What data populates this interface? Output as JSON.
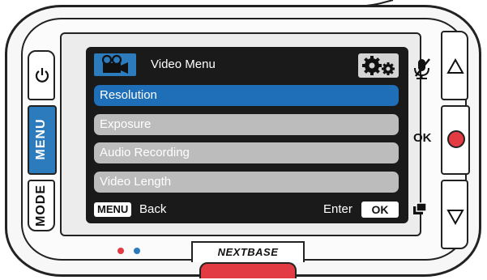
{
  "screen": {
    "title": "Video Menu",
    "items": [
      {
        "label": "Resolution",
        "selected": true
      },
      {
        "label": "Exposure",
        "selected": false
      },
      {
        "label": "Audio Recording",
        "selected": false
      },
      {
        "label": "Video Length",
        "selected": false
      }
    ],
    "footer": {
      "menu_key": "MENU",
      "back_label": "Back",
      "enter_label": "Enter",
      "ok_key": "OK"
    }
  },
  "device": {
    "menu_button_label": "MENU",
    "mode_button_label": "MODE",
    "ok_label": "OK",
    "brand": "NEXTBASE"
  },
  "icons": {
    "menu_header": "video-camera-icon",
    "settings": "gears-icon",
    "power": "power-icon",
    "mic": "mic-muted-icon",
    "up": "triangle-up-icon",
    "record": "record-dot-icon",
    "protect": "protect-file-icon",
    "down": "triangle-down-icon"
  },
  "colors": {
    "accent_blue": "#1e6fb8",
    "menu_button_blue": "#2b7bbd",
    "record_red": "#e23b44",
    "unselected_row": "#bcbcbc",
    "screen_bg": "#1a1a1a"
  }
}
